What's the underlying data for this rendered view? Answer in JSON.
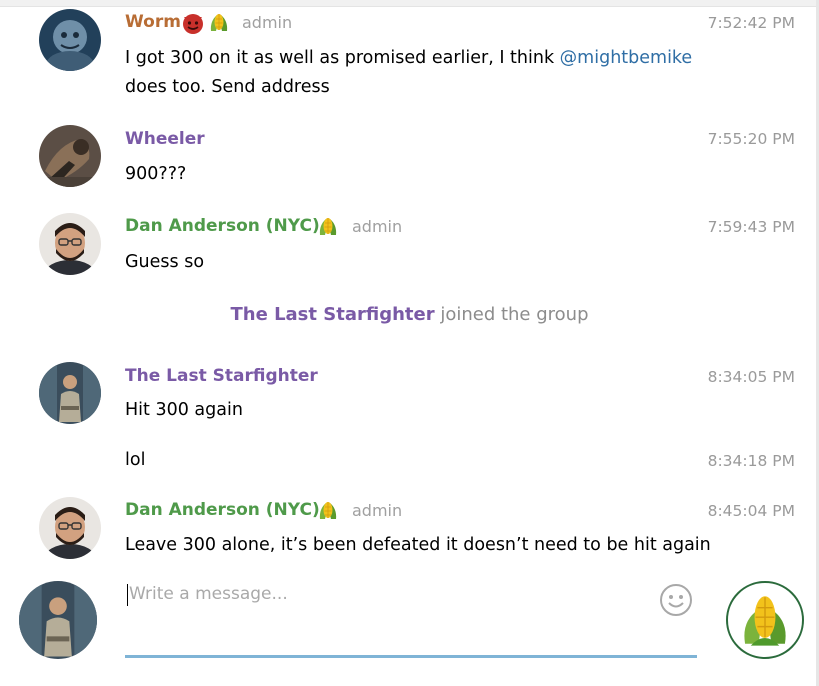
{
  "messages": [
    {
      "name": "Worm",
      "name_color": "#b86d35",
      "badges": [
        "devil-face-icon",
        "corn-icon"
      ],
      "role": "admin",
      "time": "7:52:42 PM",
      "text_line1_before": "I got 300 on it as well as promised earlier, I think ",
      "mention": "@mightbemike",
      "text_line2": "does too. Send address"
    },
    {
      "name": "Wheeler",
      "name_color": "#7a5aa6",
      "time": "7:55:20 PM",
      "text": "900???"
    },
    {
      "name": "Dan Anderson (NYC)",
      "name_color": "#4f9a4a",
      "badges": [
        "corn-icon"
      ],
      "role": "admin",
      "time": "7:59:43 PM",
      "text": "Guess so"
    },
    {
      "name": "The Last Starfighter",
      "name_color": "#7a5aa6",
      "time": "8:34:05 PM",
      "text": "Hit 300 again"
    },
    {
      "time": "8:34:18 PM",
      "text": "lol"
    },
    {
      "name": "Dan Anderson (NYC)",
      "name_color": "#4f9a4a",
      "badges": [
        "corn-icon"
      ],
      "role": "admin",
      "time": "8:45:04 PM",
      "text": "Leave 300 alone, it’s been defeated it doesn’t need to be hit again"
    }
  ],
  "service_message": {
    "name": "The Last Starfighter",
    "action": " joined the group"
  },
  "composer": {
    "placeholder": "Write a message...",
    "emoji_icon": "smiley-icon",
    "send_icon": "corn-icon"
  },
  "colors": {
    "accent_underline": "#7fb4d6",
    "timestamp": "#9a9a9a",
    "mention": "#2f6ea5"
  }
}
